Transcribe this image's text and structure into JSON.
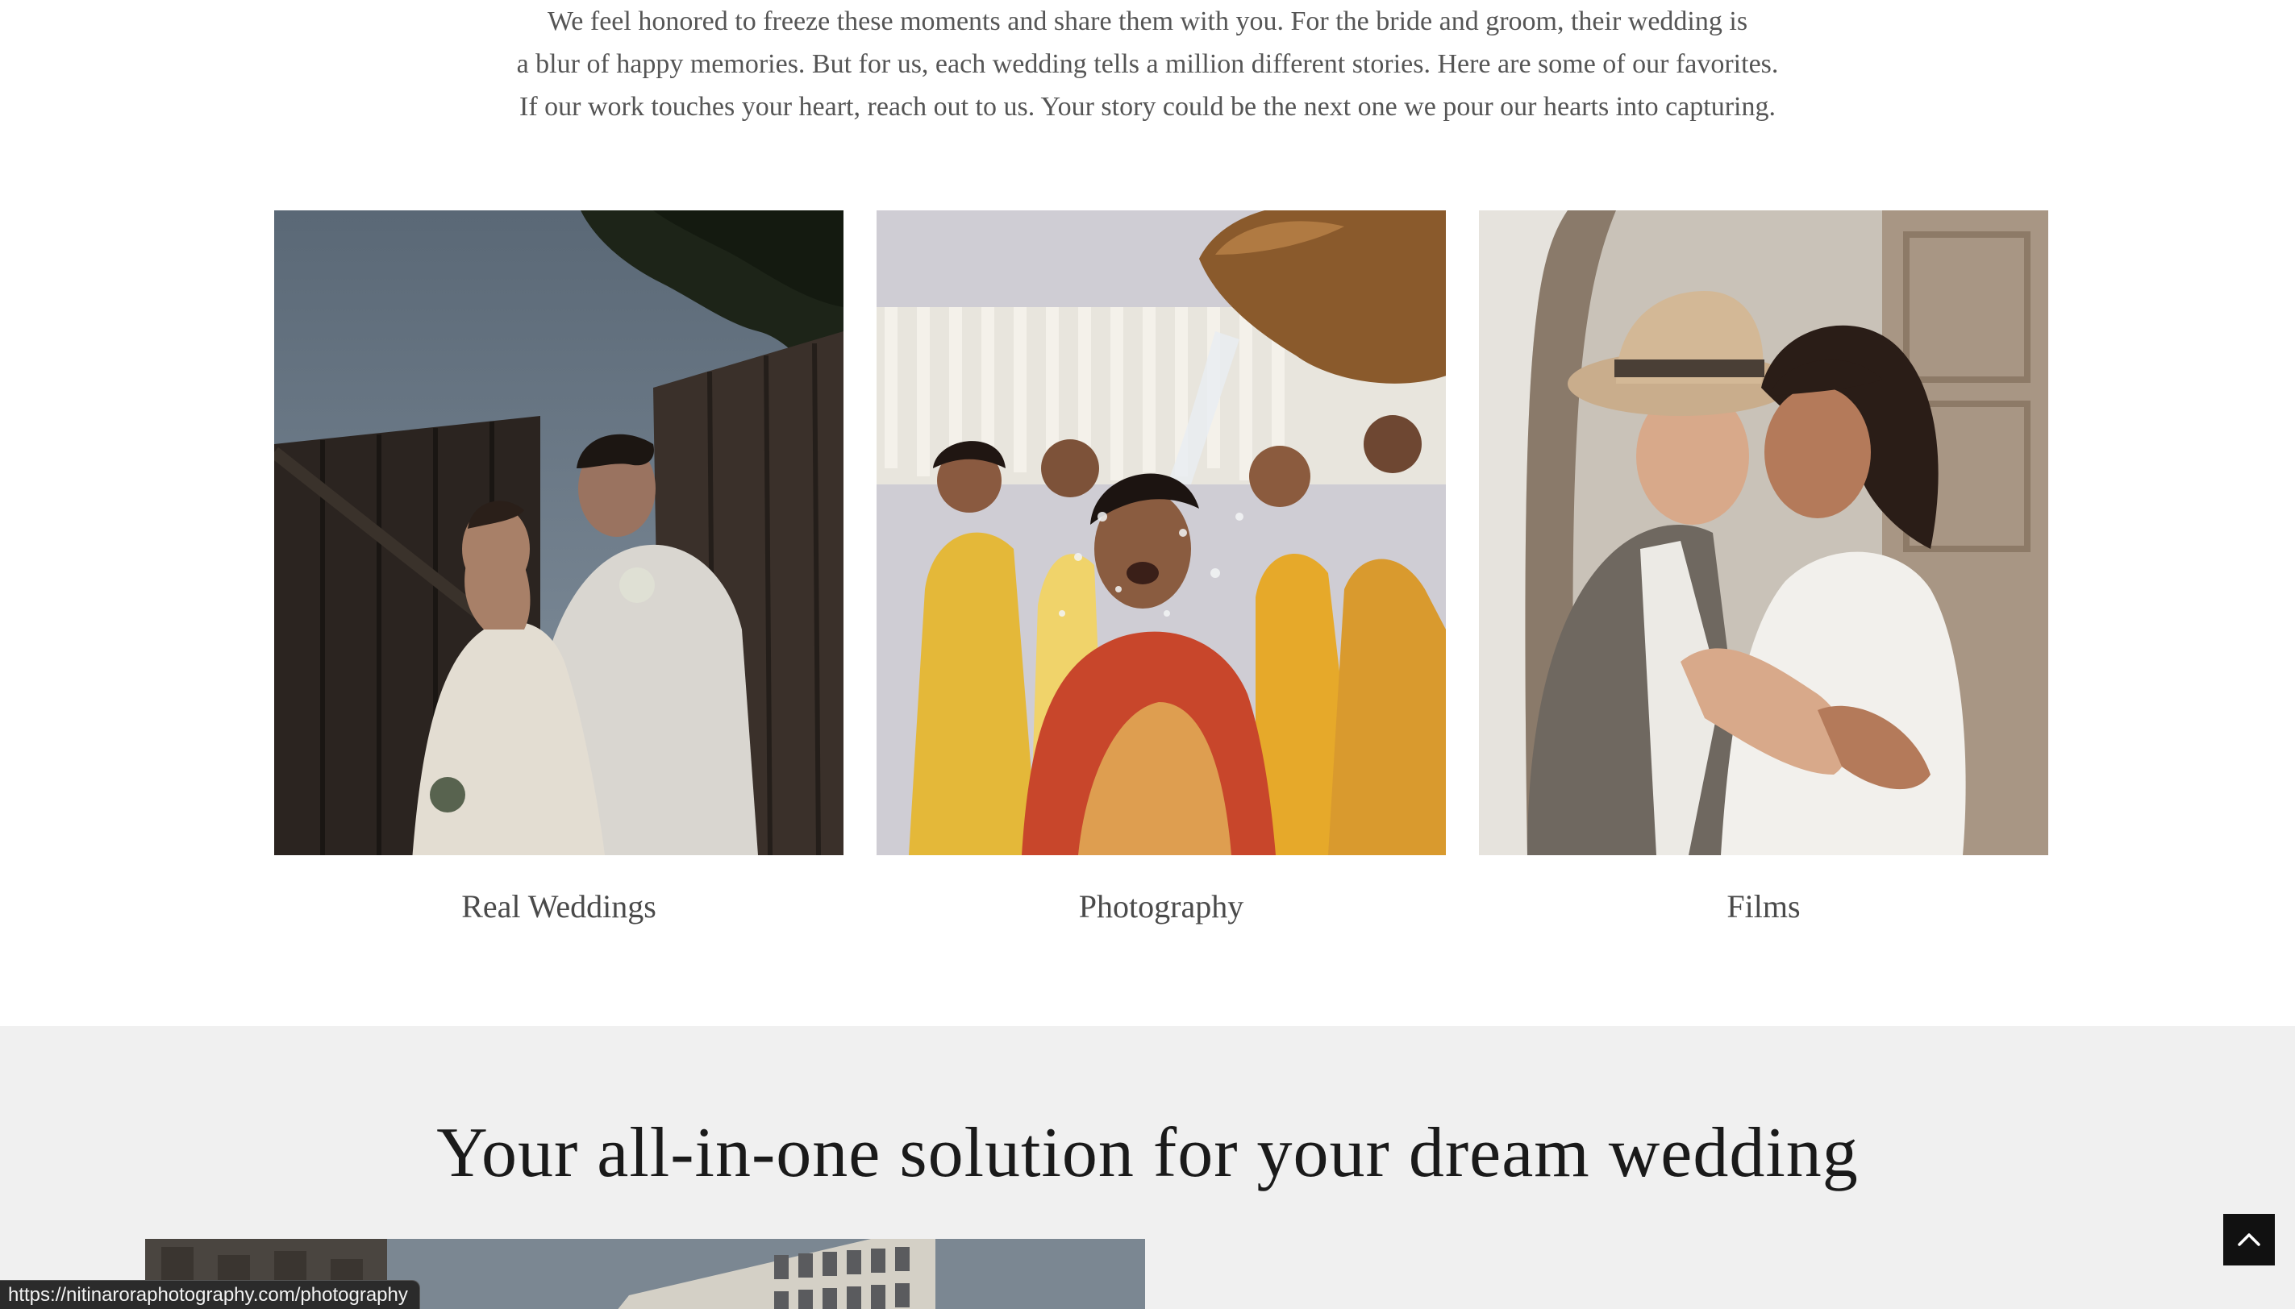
{
  "intro": {
    "lines": [
      "We feel honored to freeze these moments and share them with you. For the bride and groom, their wedding is",
      "a blur of happy memories. But for us, each wedding tells a million different stories. Here are some of our favorites.",
      "If our work touches your heart, reach out to us. Your story could be the next one we pour our hearts into capturing."
    ]
  },
  "gallery": [
    {
      "caption": "Real Weddings"
    },
    {
      "caption": "Photography"
    },
    {
      "caption": "Films"
    }
  ],
  "services": {
    "heading": "Your all-in-one solution for your dream wedding"
  },
  "status_bar": {
    "url": "https://nitinaroraphotography.com/photography"
  },
  "colors": {
    "section_bg": "#f0f0f0",
    "text": "#4a4a4a",
    "heading": "#1a1a1a",
    "button_bg": "#111111"
  },
  "icons": {
    "back_to_top": "chevron-up-icon"
  }
}
